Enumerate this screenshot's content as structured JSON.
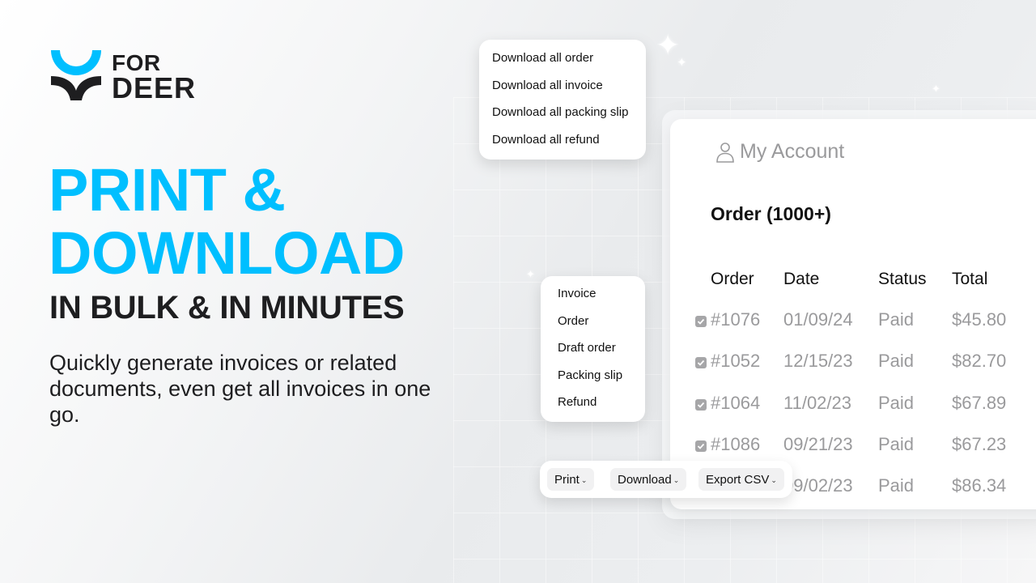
{
  "brand": {
    "name_line1": "FOR",
    "name_line2": "DEER",
    "colors": {
      "accent": "#00bfff",
      "dark": "#1e1e20"
    }
  },
  "hero": {
    "headline_line1": "PRINT &",
    "headline_line2": "DOWNLOAD",
    "subheadline": "IN BULK & IN MINUTES",
    "description": "Quickly generate invoices or related documents, even get all invoices in one go."
  },
  "download_all_menu": {
    "items": [
      "Download all order",
      "Download all invoice",
      "Download all packing slip",
      "Download all refund"
    ]
  },
  "document_type_menu": {
    "items": [
      "Invoice",
      "Order",
      "Draft order",
      "Packing slip",
      "Refund"
    ]
  },
  "account_panel": {
    "account_label": "My Account",
    "account_icon": "user-icon",
    "order_title": "Order  (1000+)",
    "columns": [
      "Order",
      "Date",
      "Status",
      "Total"
    ],
    "rows": [
      {
        "checked": true,
        "order": "#1076",
        "date": "01/09/24",
        "status": "Paid",
        "total": "$45.80"
      },
      {
        "checked": true,
        "order": "#1052",
        "date": "12/15/23",
        "status": "Paid",
        "total": "$82.70"
      },
      {
        "checked": true,
        "order": "#1064",
        "date": "11/02/23",
        "status": "Paid",
        "total": "$67.89"
      },
      {
        "checked": true,
        "order": "#1086",
        "date": "09/21/23",
        "status": "Paid",
        "total": "$67.23"
      },
      {
        "checked": true,
        "order": "",
        "date": "09/02/23",
        "status": "Paid",
        "total": "$86.34"
      }
    ]
  },
  "toolbar": {
    "buttons": [
      {
        "label": "Print",
        "icon": "chevron-down-icon"
      },
      {
        "label": "Download",
        "icon": "chevron-down-icon"
      },
      {
        "label": "Export CSV",
        "icon": "chevron-down-icon"
      }
    ]
  }
}
